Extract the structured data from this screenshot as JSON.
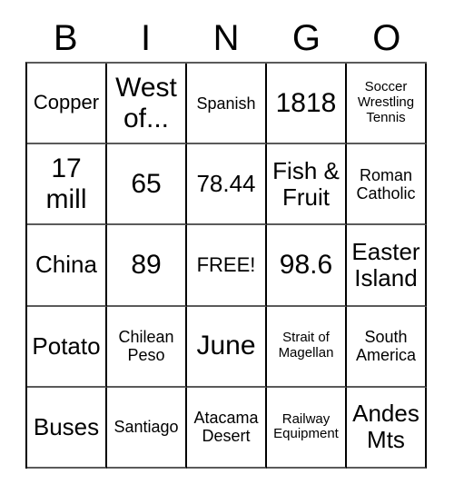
{
  "card": {
    "title": "BINGO",
    "header_letters": [
      "B",
      "I",
      "N",
      "G",
      "O"
    ],
    "free_space_label": "FREE!",
    "colors": {
      "text": "#000000",
      "grid_line_vertical": "#000000",
      "grid_line_horizontal": "#5a5a5a",
      "background": "#ffffff"
    },
    "grid": [
      [
        {
          "text": "Copper",
          "size": "md"
        },
        {
          "text": "West of...",
          "size": "xl"
        },
        {
          "text": "Spanish",
          "size": "sm"
        },
        {
          "text": "1818",
          "size": "xl"
        },
        {
          "text": "Soccer Wrestling Tennis",
          "size": "xs"
        }
      ],
      [
        {
          "text": "17 mill",
          "size": "xl"
        },
        {
          "text": "65",
          "size": "xl"
        },
        {
          "text": "78.44",
          "size": "lg"
        },
        {
          "text": "Fish & Fruit",
          "size": "lg"
        },
        {
          "text": "Roman Catholic",
          "size": "sm"
        }
      ],
      [
        {
          "text": "China",
          "size": "lg"
        },
        {
          "text": "89",
          "size": "xl"
        },
        {
          "text": "FREE!",
          "size": "md"
        },
        {
          "text": "98.6",
          "size": "xl"
        },
        {
          "text": "Easter Island",
          "size": "lg"
        }
      ],
      [
        {
          "text": "Potato",
          "size": "lg"
        },
        {
          "text": "Chilean Peso",
          "size": "sm"
        },
        {
          "text": "June",
          "size": "xl"
        },
        {
          "text": "Strait of Magellan",
          "size": "xs"
        },
        {
          "text": "South America",
          "size": "sm"
        }
      ],
      [
        {
          "text": "Buses",
          "size": "lg"
        },
        {
          "text": "Santiago",
          "size": "sm"
        },
        {
          "text": "Atacama Desert",
          "size": "sm"
        },
        {
          "text": "Railway Equipment",
          "size": "xs"
        },
        {
          "text": "Andes Mts",
          "size": "lg"
        }
      ]
    ]
  }
}
